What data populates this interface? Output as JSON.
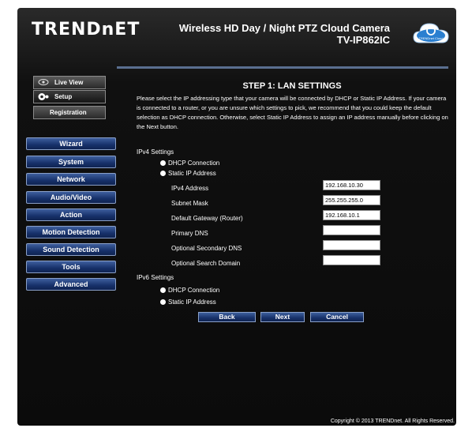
{
  "header": {
    "logo_text": "TRENDnET",
    "product_name": "Wireless HD Day / Night PTZ Cloud Camera",
    "model": "TV-IP862IC",
    "cloud_badge_text": "TRENDnet Cloud",
    "cloud_icon": "cloud-icon"
  },
  "top_buttons": [
    {
      "label": "Live View",
      "icon": "camera-icon"
    },
    {
      "label": "Setup",
      "icon": "gear-icon"
    },
    {
      "label": "Registration"
    }
  ],
  "nav": [
    {
      "label": "Wizard"
    },
    {
      "label": "System"
    },
    {
      "label": "Network"
    },
    {
      "label": "Audio/Video"
    },
    {
      "label": "Action"
    },
    {
      "label": "Motion Detection"
    },
    {
      "label": "Sound Detection"
    },
    {
      "label": "Tools"
    },
    {
      "label": "Advanced"
    }
  ],
  "content": {
    "title": "STEP 1: LAN SETTINGS",
    "intro": "Please select the IP addressing type that your camera will be connected by DHCP or Static IP Address. If your camera is connected to a router, or you are unsure which settings to pick, we recommend that you could keep the default selection as DHCP connection. Otherwise, select Static IP Address to assign an IP address manually before clicking on the Next button.",
    "ipv4": {
      "label": "IPv4 Settings",
      "options": [
        "DHCP Connection",
        "Static IP Address"
      ],
      "fields": [
        {
          "label": "IPv4 Address",
          "value": "192.168.10.30"
        },
        {
          "label": "Subnet Mask",
          "value": "255.255.255.0"
        },
        {
          "label": "Default Gateway (Router)",
          "value": "192.168.10.1"
        },
        {
          "label": "Primary DNS",
          "value": ""
        },
        {
          "label": "Optional Secondary DNS",
          "value": ""
        },
        {
          "label": "Optional Search Domain",
          "value": ""
        }
      ]
    },
    "ipv6": {
      "label": "IPv6 Settings",
      "options": [
        "DHCP Connection",
        "Static IP Address"
      ]
    },
    "buttons": {
      "back": "Back",
      "next": "Next",
      "cancel": "Cancel"
    }
  },
  "footer": "Copyright © 2013 TRENDnet. All Rights Reserved."
}
